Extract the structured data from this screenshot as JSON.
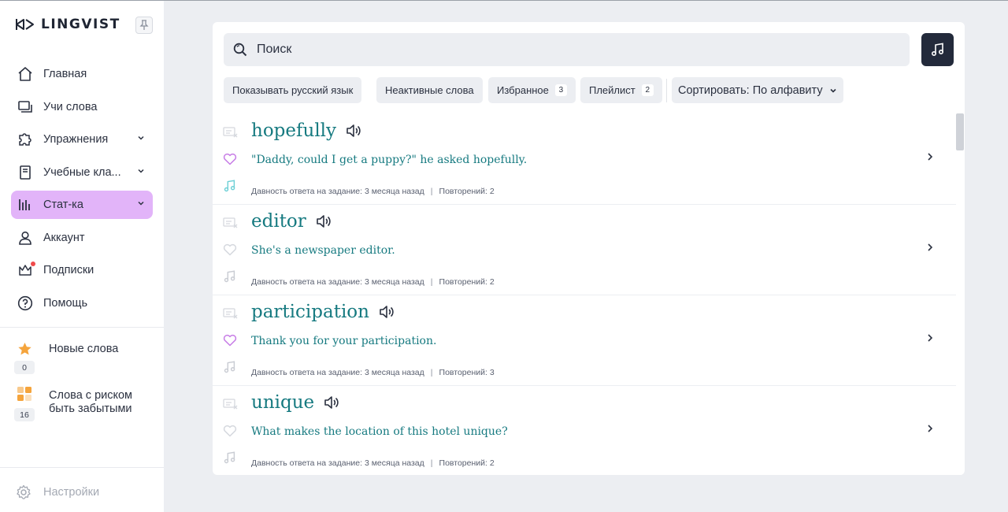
{
  "app": {
    "logo": "LINGVIST"
  },
  "sidebar": {
    "nav": [
      {
        "label": "Главная",
        "icon": "home-icon"
      },
      {
        "label": "Учи слова",
        "icon": "cards-icon"
      },
      {
        "label": "Упражнения",
        "icon": "puzzle-icon",
        "expandable": true
      },
      {
        "label": "Учебные кла...",
        "icon": "book-icon",
        "expandable": true
      },
      {
        "label": "Стат-ка",
        "icon": "stats-icon",
        "expandable": true,
        "active": true
      },
      {
        "label": "Аккаунт",
        "icon": "user-icon"
      },
      {
        "label": "Подписки",
        "icon": "crown-icon",
        "notification": true
      },
      {
        "label": "Помощь",
        "icon": "help-icon"
      }
    ],
    "stats": [
      {
        "label": "Новые слова",
        "count": "0",
        "icon": "star-icon"
      },
      {
        "label": "Слова с риском быть забытыми",
        "count": "16",
        "icon": "risk-grid-icon"
      }
    ],
    "settings_label": "Настройки",
    "active_color": "#e2b4f9"
  },
  "search": {
    "placeholder": "Поиск"
  },
  "filters": {
    "show_russian": "Показывать русский язык",
    "inactive": "Неактивные слова",
    "favorites": {
      "label": "Избранное",
      "count": "3"
    },
    "playlist": {
      "label": "Плейлист",
      "count": "2"
    },
    "sort": "Сортировать: По алфавиту"
  },
  "words": [
    {
      "word": "hopefully",
      "example": "\"Daddy, could I get a puppy?\" he asked hopefully.",
      "meta_left": "Давность ответа на задание: 3 месяца назад",
      "meta_right": "Повторений: 2",
      "favorite": true,
      "in_playlist": true
    },
    {
      "word": "editor",
      "example": "She's a newspaper editor.",
      "meta_left": "Давность ответа на задание: 3 месяца назад",
      "meta_right": "Повторений: 2",
      "favorite": false,
      "in_playlist": false
    },
    {
      "word": "participation",
      "example": "Thank you for your participation.",
      "meta_left": "Давность ответа на задание: 3 месяца назад",
      "meta_right": "Повторений: 3",
      "favorite": true,
      "in_playlist": false
    },
    {
      "word": "unique",
      "example": "What makes the location of this hotel unique?",
      "meta_left": "Давность ответа на задание: 3 месяца назад",
      "meta_right": "Повторений: 2",
      "favorite": false,
      "in_playlist": false
    }
  ],
  "colors": {
    "word": "#167a80",
    "favorite_on": "#c77de6",
    "playlist_on": "#6ed0d6",
    "dark_button": "#232a3b"
  }
}
